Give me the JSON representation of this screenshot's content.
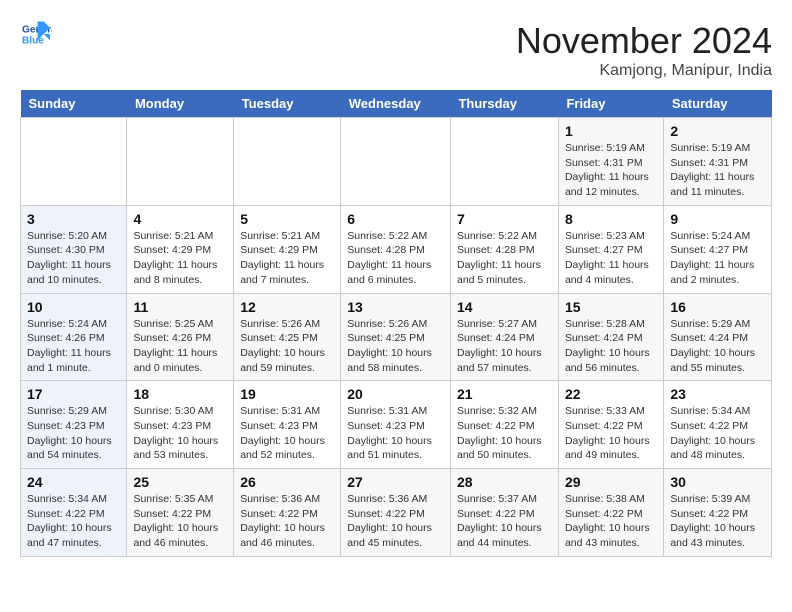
{
  "header": {
    "logo_line1": "General",
    "logo_line2": "Blue",
    "month_title": "November 2024",
    "location": "Kamjong, Manipur, India"
  },
  "weekdays": [
    "Sunday",
    "Monday",
    "Tuesday",
    "Wednesday",
    "Thursday",
    "Friday",
    "Saturday"
  ],
  "weeks": [
    [
      {
        "day": "",
        "info": ""
      },
      {
        "day": "",
        "info": ""
      },
      {
        "day": "",
        "info": ""
      },
      {
        "day": "",
        "info": ""
      },
      {
        "day": "",
        "info": ""
      },
      {
        "day": "1",
        "info": "Sunrise: 5:19 AM\nSunset: 4:31 PM\nDaylight: 11 hours and 12 minutes."
      },
      {
        "day": "2",
        "info": "Sunrise: 5:19 AM\nSunset: 4:31 PM\nDaylight: 11 hours and 11 minutes."
      }
    ],
    [
      {
        "day": "3",
        "info": "Sunrise: 5:20 AM\nSunset: 4:30 PM\nDaylight: 11 hours and 10 minutes."
      },
      {
        "day": "4",
        "info": "Sunrise: 5:21 AM\nSunset: 4:29 PM\nDaylight: 11 hours and 8 minutes."
      },
      {
        "day": "5",
        "info": "Sunrise: 5:21 AM\nSunset: 4:29 PM\nDaylight: 11 hours and 7 minutes."
      },
      {
        "day": "6",
        "info": "Sunrise: 5:22 AM\nSunset: 4:28 PM\nDaylight: 11 hours and 6 minutes."
      },
      {
        "day": "7",
        "info": "Sunrise: 5:22 AM\nSunset: 4:28 PM\nDaylight: 11 hours and 5 minutes."
      },
      {
        "day": "8",
        "info": "Sunrise: 5:23 AM\nSunset: 4:27 PM\nDaylight: 11 hours and 4 minutes."
      },
      {
        "day": "9",
        "info": "Sunrise: 5:24 AM\nSunset: 4:27 PM\nDaylight: 11 hours and 2 minutes."
      }
    ],
    [
      {
        "day": "10",
        "info": "Sunrise: 5:24 AM\nSunset: 4:26 PM\nDaylight: 11 hours and 1 minute."
      },
      {
        "day": "11",
        "info": "Sunrise: 5:25 AM\nSunset: 4:26 PM\nDaylight: 11 hours and 0 minutes."
      },
      {
        "day": "12",
        "info": "Sunrise: 5:26 AM\nSunset: 4:25 PM\nDaylight: 10 hours and 59 minutes."
      },
      {
        "day": "13",
        "info": "Sunrise: 5:26 AM\nSunset: 4:25 PM\nDaylight: 10 hours and 58 minutes."
      },
      {
        "day": "14",
        "info": "Sunrise: 5:27 AM\nSunset: 4:24 PM\nDaylight: 10 hours and 57 minutes."
      },
      {
        "day": "15",
        "info": "Sunrise: 5:28 AM\nSunset: 4:24 PM\nDaylight: 10 hours and 56 minutes."
      },
      {
        "day": "16",
        "info": "Sunrise: 5:29 AM\nSunset: 4:24 PM\nDaylight: 10 hours and 55 minutes."
      }
    ],
    [
      {
        "day": "17",
        "info": "Sunrise: 5:29 AM\nSunset: 4:23 PM\nDaylight: 10 hours and 54 minutes."
      },
      {
        "day": "18",
        "info": "Sunrise: 5:30 AM\nSunset: 4:23 PM\nDaylight: 10 hours and 53 minutes."
      },
      {
        "day": "19",
        "info": "Sunrise: 5:31 AM\nSunset: 4:23 PM\nDaylight: 10 hours and 52 minutes."
      },
      {
        "day": "20",
        "info": "Sunrise: 5:31 AM\nSunset: 4:23 PM\nDaylight: 10 hours and 51 minutes."
      },
      {
        "day": "21",
        "info": "Sunrise: 5:32 AM\nSunset: 4:22 PM\nDaylight: 10 hours and 50 minutes."
      },
      {
        "day": "22",
        "info": "Sunrise: 5:33 AM\nSunset: 4:22 PM\nDaylight: 10 hours and 49 minutes."
      },
      {
        "day": "23",
        "info": "Sunrise: 5:34 AM\nSunset: 4:22 PM\nDaylight: 10 hours and 48 minutes."
      }
    ],
    [
      {
        "day": "24",
        "info": "Sunrise: 5:34 AM\nSunset: 4:22 PM\nDaylight: 10 hours and 47 minutes."
      },
      {
        "day": "25",
        "info": "Sunrise: 5:35 AM\nSunset: 4:22 PM\nDaylight: 10 hours and 46 minutes."
      },
      {
        "day": "26",
        "info": "Sunrise: 5:36 AM\nSunset: 4:22 PM\nDaylight: 10 hours and 46 minutes."
      },
      {
        "day": "27",
        "info": "Sunrise: 5:36 AM\nSunset: 4:22 PM\nDaylight: 10 hours and 45 minutes."
      },
      {
        "day": "28",
        "info": "Sunrise: 5:37 AM\nSunset: 4:22 PM\nDaylight: 10 hours and 44 minutes."
      },
      {
        "day": "29",
        "info": "Sunrise: 5:38 AM\nSunset: 4:22 PM\nDaylight: 10 hours and 43 minutes."
      },
      {
        "day": "30",
        "info": "Sunrise: 5:39 AM\nSunset: 4:22 PM\nDaylight: 10 hours and 43 minutes."
      }
    ]
  ]
}
